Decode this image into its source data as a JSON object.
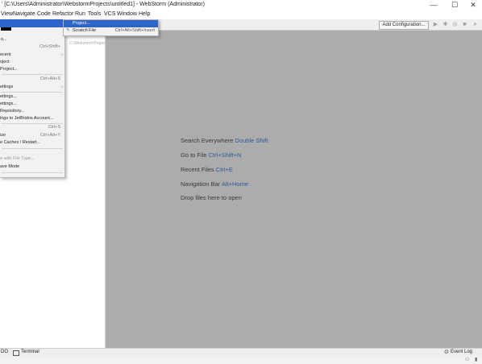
{
  "window": {
    "title": "' [C:\\Users\\Administrator\\WebstormProjects\\untitled1] - WebStorm (Administrator)",
    "controls": [
      "—",
      "☐",
      "✕"
    ]
  },
  "menubar": [
    "View",
    "Navigate",
    "Code",
    "Refactor",
    "Run",
    "Tools",
    "VCS",
    "Window",
    "Help"
  ],
  "toolbar": {
    "add_configuration": "Add Configuration...",
    "icons": [
      "run-icon",
      "debug-icon",
      "coverage-icon",
      "stop-icon",
      "search-everywhere-icon"
    ]
  },
  "project_panel": {
    "breadcrumb": "C:\\Webstorm\\Projec"
  },
  "file_menu": {
    "items": [
      {
        "label": "",
        "shortcut": "",
        "highlight": true
      },
      {
        "label": "",
        "shortcut": "Ctrl+Shift+",
        "highlight": false
      },
      {
        "label": "ecent",
        "shortcut": "",
        "arrow": true
      },
      {
        "label": "oject",
        "shortcut": ""
      },
      {
        "label": "Project...",
        "shortcut": ""
      },
      {
        "label": "",
        "shortcut": "Ctrl+Alt+S"
      },
      {
        "label": "ettings",
        "shortcut": "",
        "arrow": true
      },
      {
        "label": "ettings...",
        "shortcut": ""
      },
      {
        "label": "ettings...",
        "shortcut": ""
      },
      {
        "label": "Repository...",
        "shortcut": ""
      },
      {
        "label": "ings to JetBrains Account...",
        "shortcut": ""
      },
      {
        "label": "",
        "shortcut": "Ctrl+S"
      },
      {
        "label": "ize",
        "shortcut": "Ctrl+Alt+Y"
      },
      {
        "label": "e Caches / Restart...",
        "shortcut": ""
      },
      {
        "label": "e with File Type...",
        "shortcut": "",
        "disabled": true
      },
      {
        "label": "ave Mode",
        "shortcut": ""
      }
    ]
  },
  "new_submenu": {
    "items": [
      {
        "label": "Project...",
        "shortcut": "",
        "icon": "",
        "highlight": true
      },
      {
        "label": "Scratch File",
        "shortcut": "Ctrl+Alt+Shift+Insert",
        "icon": "✎"
      }
    ]
  },
  "editor_hints": [
    {
      "text": "Search Everywhere ",
      "key": "Double Shift"
    },
    {
      "text": "Go to File ",
      "key": "Ctrl+Shift+N"
    },
    {
      "text": "Recent Files ",
      "key": "Ctrl+E"
    },
    {
      "text": "Navigation Bar ",
      "key": "Alt+Home"
    },
    {
      "text": "Drop files here to open",
      "key": ""
    }
  ],
  "toolwindow_bar": {
    "todo": "DO",
    "terminal": "Terminal",
    "event_log": "Event Log"
  },
  "colors": {
    "editor_bg": "#acacac",
    "selection": "#2f65ca",
    "shortcut_text": "#2e5a9c"
  }
}
